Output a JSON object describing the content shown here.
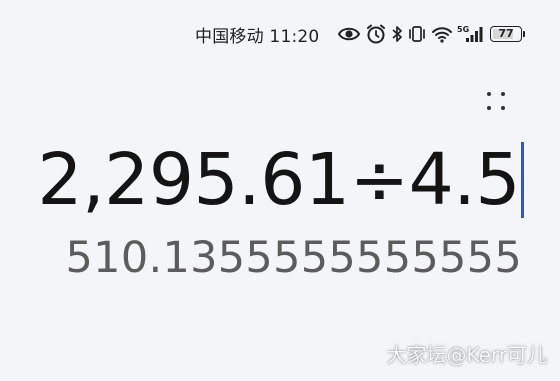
{
  "status_bar": {
    "carrier": "中国移动",
    "time": "11:20",
    "icons": [
      "eye-icon",
      "alarm-icon",
      "bluetooth-icon",
      "vibrate-icon",
      "wifi-icon",
      "cellular-5g-icon"
    ],
    "network_label": "5G",
    "battery_level": "77",
    "battery_fraction": 0.77
  },
  "calculator": {
    "expression": "2,295.61÷4.5",
    "result": "510.1355555555555",
    "menu_icon": "more-dots-icon",
    "cursor_color": "#1f5ed6"
  },
  "watermark": "大家坛@Kerr可儿",
  "colors": {
    "background": "#f4f5f9",
    "expression_text": "#141414",
    "result_text": "#5c5c5c"
  }
}
